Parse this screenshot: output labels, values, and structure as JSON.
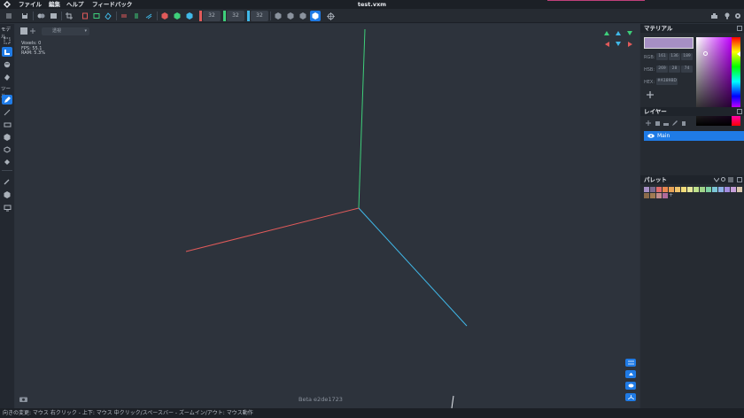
{
  "app": {
    "title": "test.vxm"
  },
  "menu": [
    "ファイル",
    "編集",
    "ヘルプ",
    "フィードバック"
  ],
  "toolbar": {
    "size_x": "32",
    "size_y": "32",
    "size_z": "32"
  },
  "left": {
    "label_model": "モデル",
    "label_tool": "ツール"
  },
  "viewport": {
    "view_select": "透視",
    "stats": [
      "Voxels: 0",
      "FPS: 55.1",
      "RAM: 5.3%"
    ],
    "beta": "Beta e2de1723"
  },
  "material": {
    "title": "マテリアル",
    "swatch_color": "#a68fc4",
    "rgb_label": "RGB:",
    "rgb": [
      "161",
      "136",
      "189"
    ],
    "hsb_label": "HSB:",
    "hsb": [
      "269",
      "28",
      "74"
    ],
    "hex_label": "HEX:",
    "hex": "#A189BD"
  },
  "layers": {
    "title": "レイヤー",
    "items": [
      {
        "name": "Main",
        "visible": true
      }
    ]
  },
  "palette": {
    "title": "パレット",
    "colors": [
      "#a68fc4",
      "#7b6a8f",
      "#e06a6a",
      "#e8874f",
      "#e8a356",
      "#efc46c",
      "#f2dc7a",
      "#e8e89a",
      "#bfe28c",
      "#9fd48a",
      "#7ccfa1",
      "#7cc6d6",
      "#8cb0e6",
      "#a28ce0",
      "#c69fd8",
      "#d8c6ac",
      "#8a6a4a",
      "#a07a52",
      "#c28c8c",
      "#b06a9a"
    ]
  },
  "statusbar": {
    "text": "向きの変更: マウス 右クリック - 上下: マウス 中クリック/スペースバー - ズームイン/アウト: マウス動作"
  },
  "colors": {
    "accent": "#1f7be6",
    "axis_x": "#e05a5a",
    "axis_y": "#3ecf7a",
    "axis_z": "#40b8e8"
  }
}
